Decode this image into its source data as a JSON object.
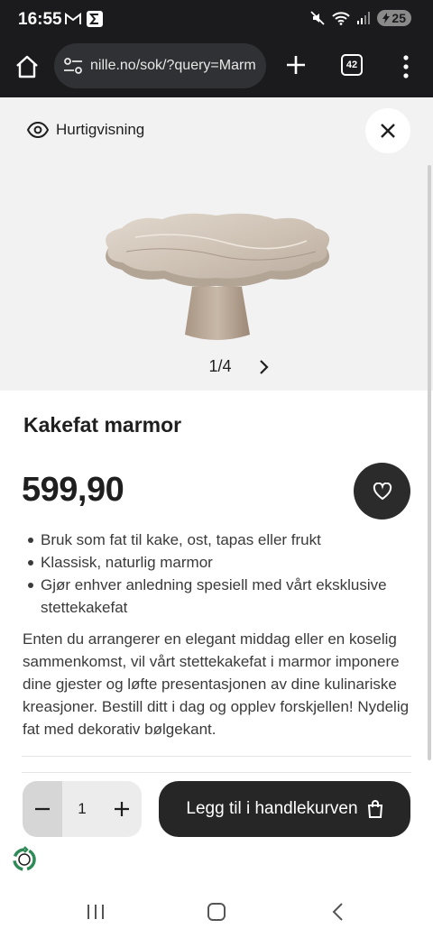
{
  "status_bar": {
    "time": "16:55",
    "battery": "25",
    "left_icons": [
      "gmail-icon",
      "sigma-app-icon"
    ],
    "right_icons": [
      "mute-icon",
      "wifi-icon",
      "signal-icon",
      "battery-icon"
    ]
  },
  "browser": {
    "url": "nille.no/sok/?query=Marm",
    "tab_count": "42"
  },
  "quick_view": {
    "label": "Hurtigvisning",
    "image_counter": "1/4"
  },
  "product": {
    "title": "Kakefat marmor",
    "price": "599,90",
    "bullets": [
      "Bruk som fat til kake, ost, tapas eller frukt",
      "Klassisk, naturlig marmor",
      "Gjør enhver anledning spesiell med vårt eksklusive stettekakefat"
    ],
    "description": "Enten du arrangerer en elegant middag eller en koselig sammenkomst, vil vårt stettekakefat i marmor imponere dine gjester og løfte presentasjonen av dine kulinariske kreasjoner. Bestill ditt i dag og opplev forskjellen! Nydelig fat med dekorativ bølgekant."
  },
  "cart": {
    "quantity": "1",
    "button_label": "Legg til i handlekurven"
  },
  "colors": {
    "dark": "#262626",
    "chrome": "#1b1b1d",
    "gallery_bg": "#f2f2f2"
  }
}
